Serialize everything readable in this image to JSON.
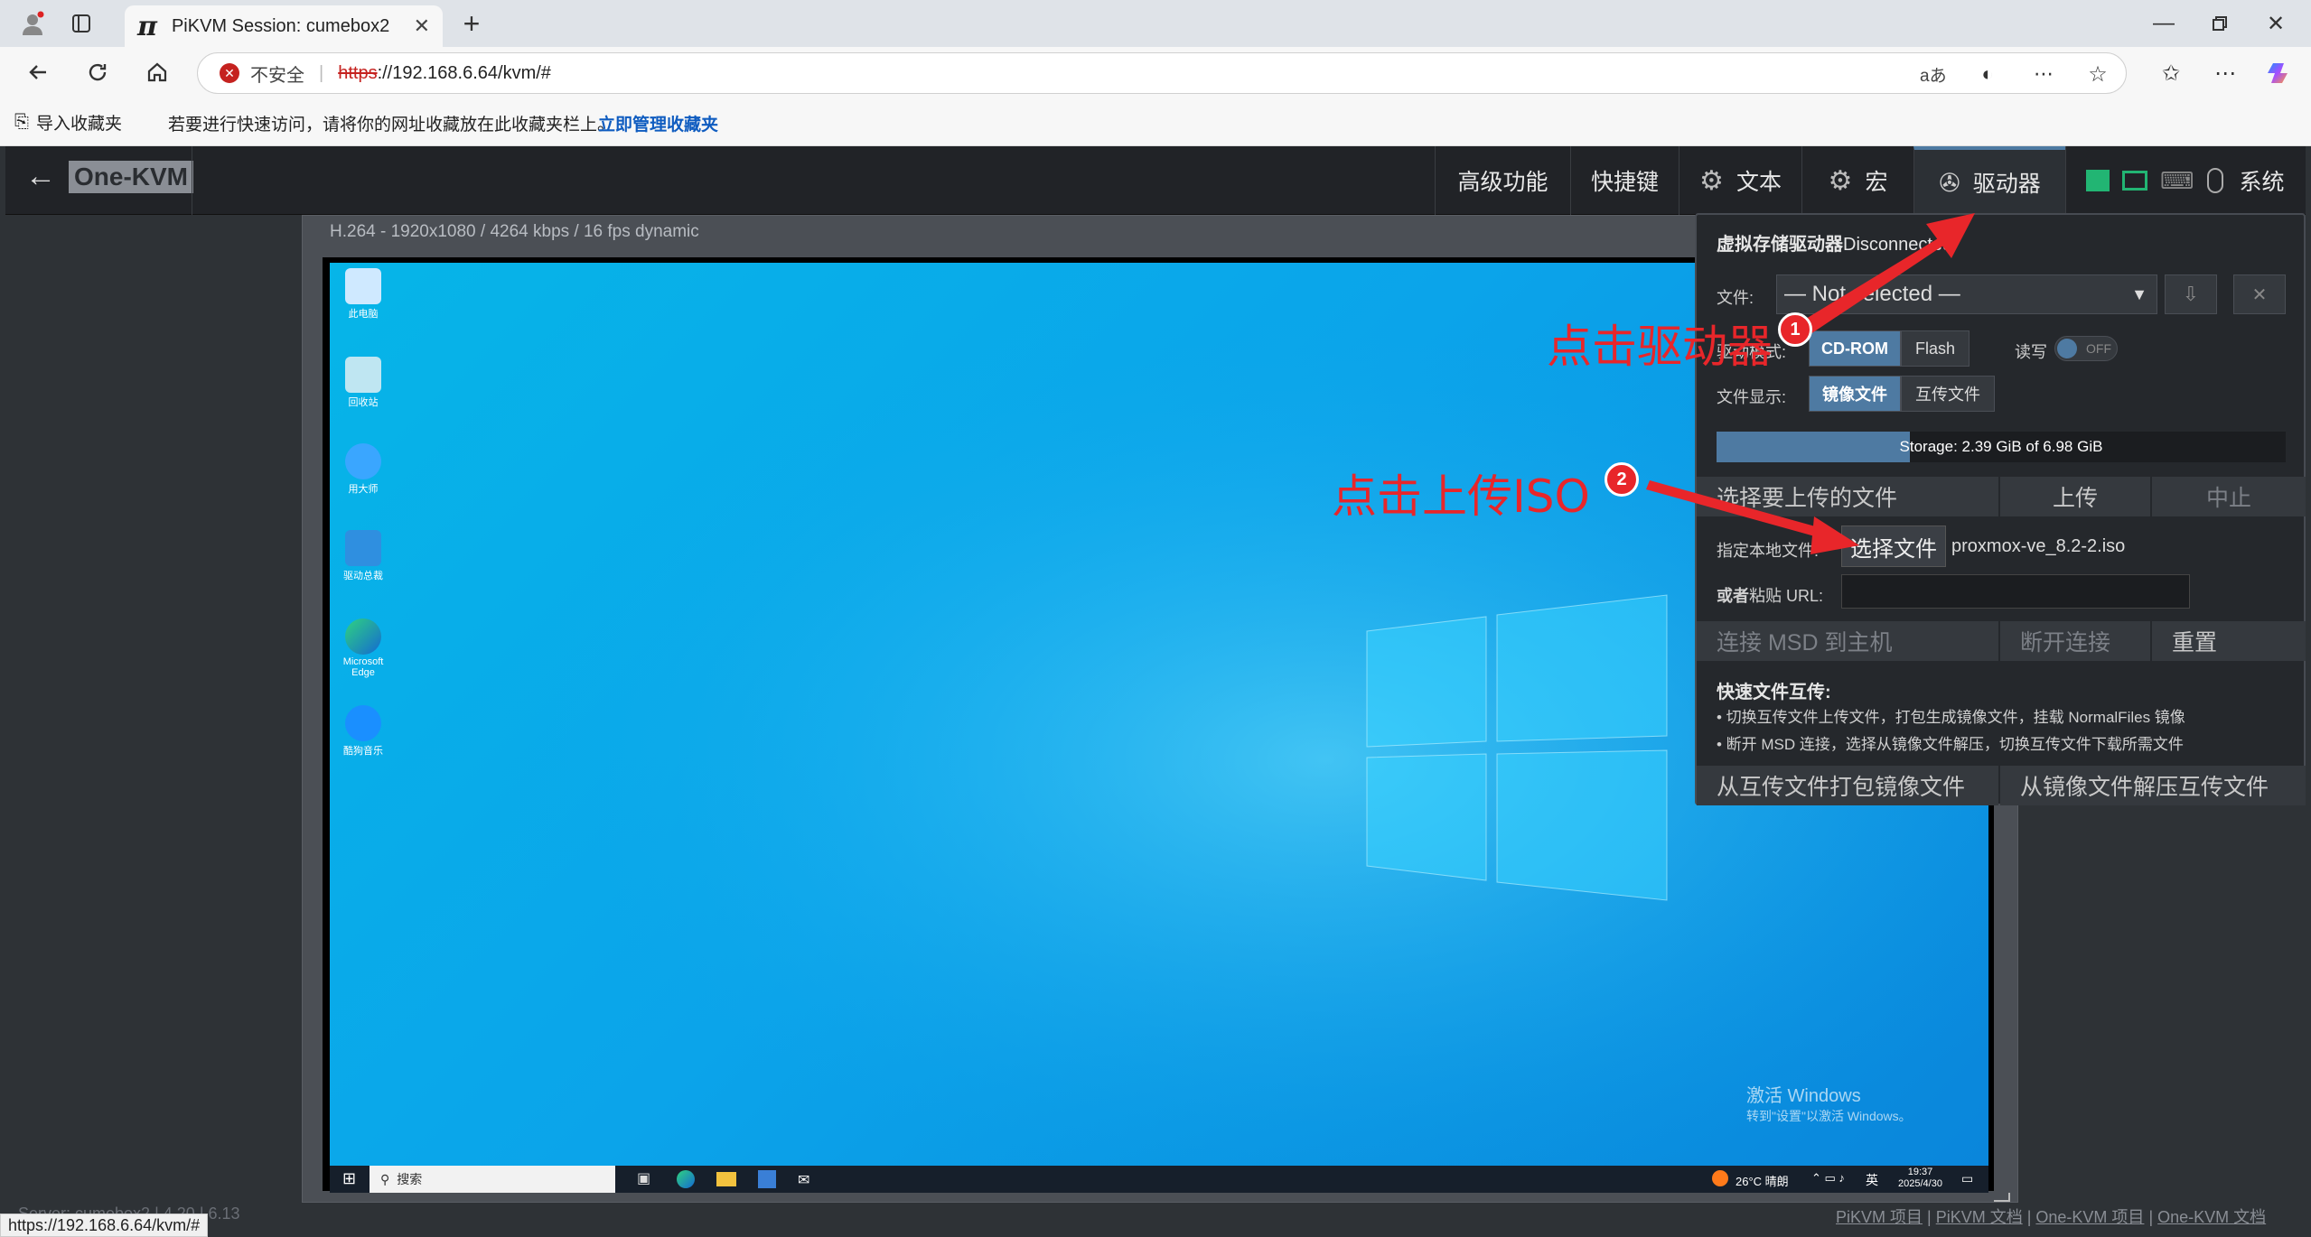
{
  "browser": {
    "tab_title": "PiKVM Session: cumebox2",
    "insecure": "不安全",
    "url_scheme": "https",
    "url_rest": "://192.168.6.64/kvm/#",
    "read_aloud": "aあ",
    "fav_import": "导入收藏夹",
    "fav_hint": "若要进行快速访问，请将你的网址收藏放在此收藏夹栏上。",
    "fav_manage": "立即管理收藏夹"
  },
  "kvm": {
    "brand": "One-KVM",
    "nav": {
      "advanced": "高级功能",
      "hotkeys": "快捷键",
      "text": "文本",
      "macro": "宏",
      "drive": "驱动器",
      "system": "系统"
    },
    "stream_info": "H.264 - 1920x1080 / 4264 kbps / 16 fps dynamic"
  },
  "desktop": {
    "icons": [
      "此电脑",
      "回收站",
      "用大师",
      "驱动总裁",
      "Microsoft Edge",
      "酷狗音乐"
    ],
    "search": "搜索",
    "weather": "26°C 晴朗",
    "ime": "英",
    "time": "19:37",
    "date": "2025/4/30",
    "activate_title": "激活 Windows",
    "activate_sub": "转到\"设置\"以激活 Windows。"
  },
  "drive": {
    "title": "虚拟存储驱动器",
    "status": "Disconnected",
    "file_label": "文件:",
    "file_select": "— Not selected —",
    "mode_label": "驱动模式:",
    "mode_cdrom": "CD-ROM",
    "mode_flash": "Flash",
    "rw_label": "读写",
    "rw_toggle": "OFF",
    "display_label": "文件显示:",
    "display_image": "镜像文件",
    "display_share": "互传文件",
    "storage": "Storage: 2.39 GiB of 6.98 GiB",
    "storage_fraction": 0.34,
    "upload_select": "选择要上传的文件",
    "upload_btn": "上传",
    "abort_btn": "中止",
    "local_label": "指定本地文件:",
    "choose_file": "选择文件",
    "chosen_name": "proxmox-ve_8.2-2.iso",
    "url_label_a": "或者",
    "url_label_b": "粘贴 URL:",
    "connect": "连接 MSD 到主机",
    "disconnect": "断开连接",
    "reset": "重置",
    "quick_title": "快速文件互传:",
    "quick_1": "• 切换互传文件上传文件，打包生成镜像文件，挂载 NormalFiles 镜像",
    "quick_2": "• 断开 MSD 连接，选择从镜像文件解压，切换互传文件下载所需文件",
    "pack": "从互传文件打包镜像文件",
    "unpack": "从镜像文件解压互传文件"
  },
  "annotations": {
    "a1": "点击驱动器",
    "a2": "点击上传ISO",
    "b1": "1",
    "b2": "2"
  },
  "footer": {
    "server": "Server: cumebox2",
    "ver1": "4.20",
    "ver2": "6.13",
    "link1": "PiKVM 项目",
    "link2": "PiKVM 文档",
    "link3": "One-KVM 项目",
    "link4": "One-KVM 文档",
    "status_url": "https://192.168.6.64/kvm/#"
  },
  "colors": {
    "panel": "#25282c",
    "accent": "#4e7aa2",
    "annotation": "#e8262a"
  }
}
